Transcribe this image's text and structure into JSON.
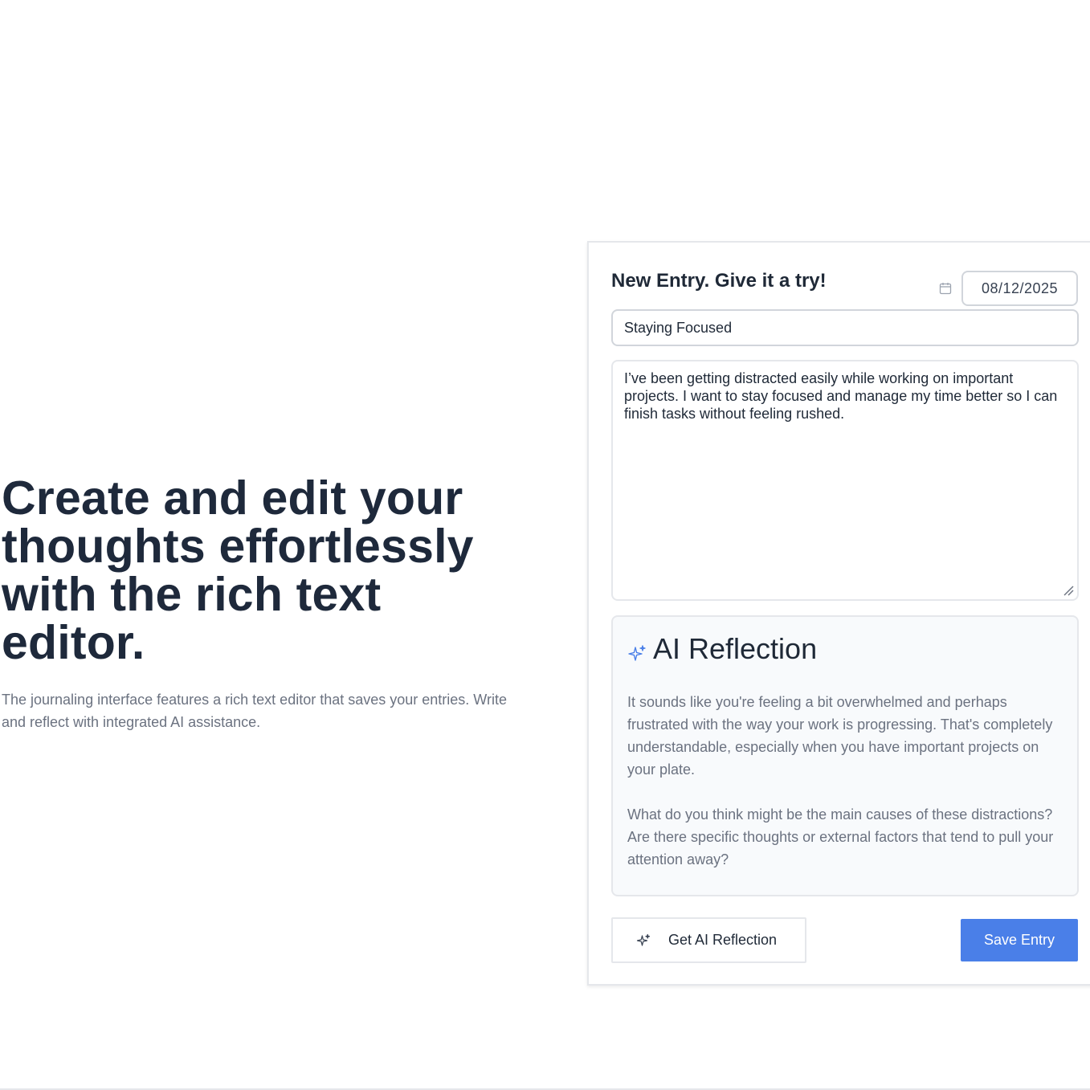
{
  "hero": {
    "title": "Create and edit your thoughts effortlessly with the rich text editor.",
    "description": "The journaling interface features a rich text editor that saves your entries. Write and reflect with integrated AI assistance."
  },
  "entry": {
    "heading": "New Entry. Give it a try!",
    "date": "08/12/2025",
    "title_value": "Staying Focused",
    "body_value": "I’ve been getting distracted easily while working on important projects. I want to stay focused and manage my time better so I can finish tasks without feeling rushed."
  },
  "reflection": {
    "title": "AI Reflection",
    "paragraph_1": "It sounds like you're feeling a bit overwhelmed and perhaps frustrated with the way your work is progressing. That's completely understandable, especially when you have important projects on your plate.",
    "paragraph_2": "What do you think might be the main causes of these distractions? Are there specific thoughts or external factors that tend to pull your attention away?"
  },
  "actions": {
    "ai_button_label": "Get AI Reflection",
    "save_button_label": "Save Entry"
  },
  "colors": {
    "accent": "#4a7fe8",
    "heading": "#1e293b",
    "muted": "#6b7280"
  },
  "icons": {
    "calendar": "calendar-icon",
    "sparkle": "sparkle-icon",
    "resize": "resize-handle-icon"
  }
}
